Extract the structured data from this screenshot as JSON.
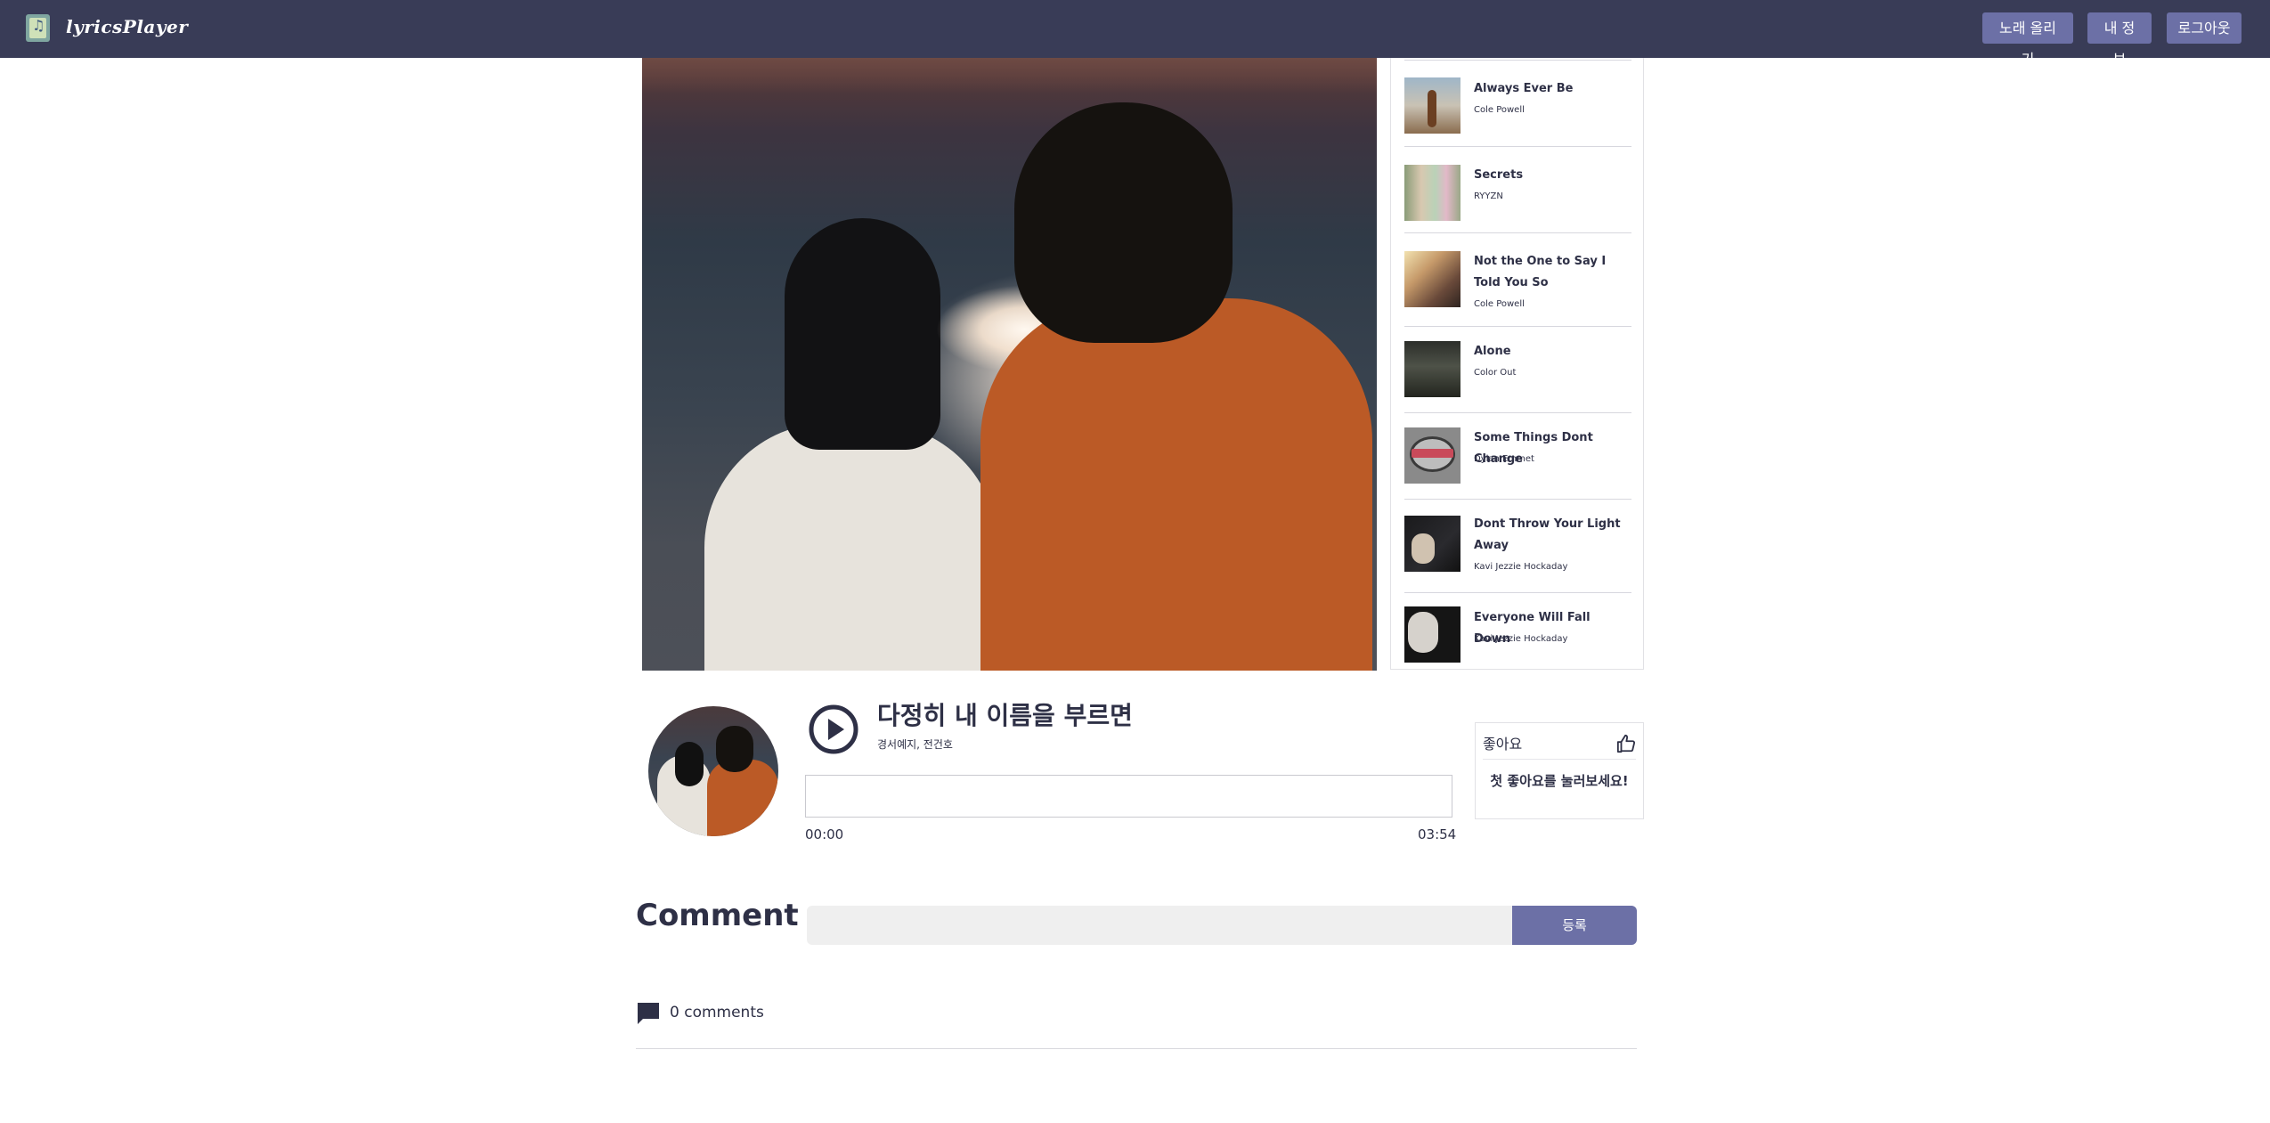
{
  "header": {
    "brand": "lyricsPlayer",
    "buttons": {
      "upload": "노래 올리기",
      "my_info": "내 정보",
      "logout": "로그아웃"
    }
  },
  "playlist": [
    {
      "title": "Always Ever Be",
      "artist": "Cole Powell"
    },
    {
      "title": "Secrets",
      "artist": "RYYZN"
    },
    {
      "title": "Not the One to Say I Told You So",
      "artist": "Cole Powell"
    },
    {
      "title": "Alone",
      "artist": "Color Out"
    },
    {
      "title": "Some Things Dont Change",
      "artist": "Dylan Emmet"
    },
    {
      "title": "Dont Throw Your Light Away",
      "artist": "Kavi Jezzie Hockaday"
    },
    {
      "title": "Everyone Will Fall Down",
      "artist": "Kavi Jezzie Hockaday"
    }
  ],
  "player": {
    "title": "다정히 내 이름을 부르면",
    "artist": "경서예지, 전건호",
    "current_time": "00:00",
    "total_time": "03:54"
  },
  "like": {
    "label": "좋아요",
    "message": "첫 좋아요를 눌러보세요!"
  },
  "comments": {
    "heading": "Comment",
    "input_value": "",
    "submit_label": "등록",
    "count_text": "0 comments"
  },
  "colors": {
    "header_bg": "#393c57",
    "accent": "#6c70a6",
    "text": "#2e3046"
  }
}
